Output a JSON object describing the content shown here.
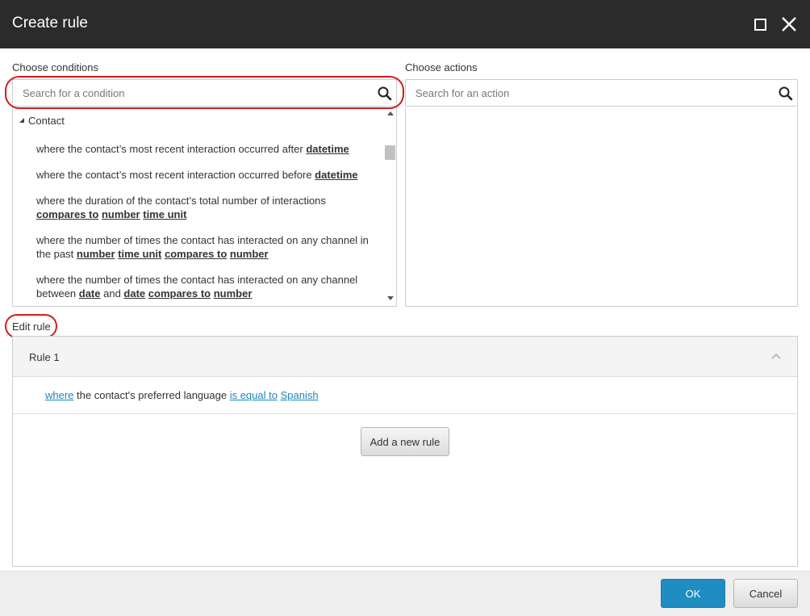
{
  "dialog": {
    "title": "Create rule",
    "icons": {
      "maximize": "maximize-icon",
      "close": "close-icon"
    }
  },
  "conditions": {
    "label": "Choose conditions",
    "search_placeholder": "Search for a condition",
    "group": "Contact",
    "items": [
      {
        "segments": [
          {
            "text": "where the contact’s most recent interaction occurred after "
          },
          {
            "text": "datetime",
            "link": true
          }
        ]
      },
      {
        "segments": [
          {
            "text": "where the contact’s most recent interaction occurred before "
          },
          {
            "text": "datetime",
            "link": true
          }
        ]
      },
      {
        "segments": [
          {
            "text": "where the duration of the contact’s total number of interactions "
          },
          {
            "text": "compares to",
            "link": true
          },
          {
            "text": " "
          },
          {
            "text": "number",
            "link": true
          },
          {
            "text": " "
          },
          {
            "text": "time unit",
            "link": true
          }
        ]
      },
      {
        "segments": [
          {
            "text": "where the number of times the contact has interacted on any channel in the past "
          },
          {
            "text": "number",
            "link": true
          },
          {
            "text": " "
          },
          {
            "text": "time unit",
            "link": true
          },
          {
            "text": " "
          },
          {
            "text": "compares to",
            "link": true
          },
          {
            "text": " "
          },
          {
            "text": "number",
            "link": true
          }
        ]
      },
      {
        "segments": [
          {
            "text": "where the number of times the contact has interacted on any channel between "
          },
          {
            "text": "date",
            "link": true
          },
          {
            "text": " and "
          },
          {
            "text": "date",
            "link": true
          },
          {
            "text": " "
          },
          {
            "text": "compares to",
            "link": true
          },
          {
            "text": " "
          },
          {
            "text": "number",
            "link": true
          }
        ]
      }
    ]
  },
  "actions": {
    "label": "Choose actions",
    "search_placeholder": "Search for an action"
  },
  "edit_rule": {
    "label": "Edit rule",
    "rule_title": "Rule 1",
    "rule_text": {
      "where": "where",
      "middle": " the contact's preferred language ",
      "operator": "is equal to",
      "space": " ",
      "value": "Spanish"
    },
    "add_button": "Add a new rule"
  },
  "footer": {
    "ok": "OK",
    "cancel": "Cancel"
  },
  "colors": {
    "titlebar": "#2b2b2b",
    "primary": "#1f8dc2",
    "link": "#1a87b9",
    "annotation": "#d9191c"
  }
}
